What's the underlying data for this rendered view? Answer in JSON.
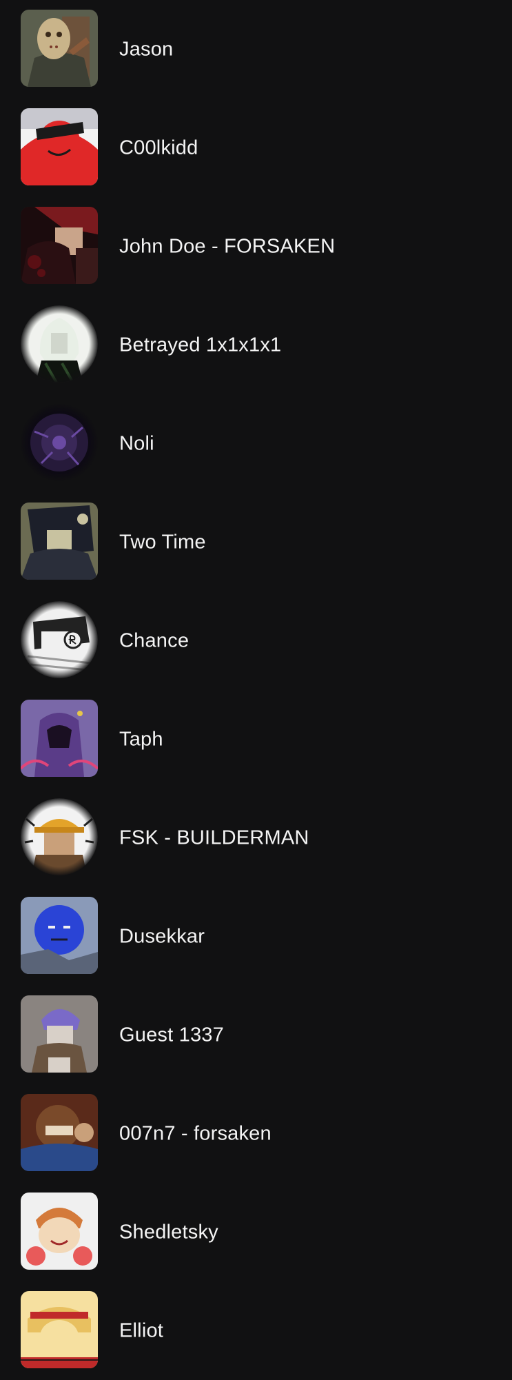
{
  "contacts": [
    {
      "name": "Jason",
      "avatar_icon": "hockey-mask-avatar",
      "colors": [
        "#5b5f4e",
        "#c9b48a",
        "#8a5a3a"
      ]
    },
    {
      "name": "C00lkidd",
      "avatar_icon": "red-kid-sunglasses-avatar",
      "colors": [
        "#e02828",
        "#1a1a1a",
        "#ffffff"
      ]
    },
    {
      "name": "John Doe - FORSAKEN",
      "avatar_icon": "dark-red-figure-avatar",
      "colors": [
        "#1b0b0d",
        "#7a1a1e",
        "#c9a48a"
      ]
    },
    {
      "name": "Betrayed 1x1x1x1",
      "avatar_icon": "white-haired-figure-avatar",
      "colors": [
        "#e8efe6",
        "#2d4a2a",
        "#0f140f"
      ]
    },
    {
      "name": "Noli",
      "avatar_icon": "purple-void-avatar",
      "colors": [
        "#261a3a",
        "#6a4aa2",
        "#0d0a14"
      ]
    },
    {
      "name": "Two Time",
      "avatar_icon": "dark-haired-figure-avatar",
      "colors": [
        "#1c1f2a",
        "#6b6b52",
        "#c8c2a0"
      ]
    },
    {
      "name": "Chance",
      "avatar_icon": "sketch-figure-avatar",
      "colors": [
        "#f0f0f0",
        "#222222",
        "#9a9a9a"
      ]
    },
    {
      "name": "Taph",
      "avatar_icon": "hooded-purple-avatar",
      "colors": [
        "#5a3c88",
        "#1a0f22",
        "#e0457a"
      ]
    },
    {
      "name": "FSK - BUILDERMAN",
      "avatar_icon": "builder-hat-avatar",
      "colors": [
        "#e3a32a",
        "#6a4a2e",
        "#f2f2f2"
      ]
    },
    {
      "name": "Dusekkar",
      "avatar_icon": "blue-face-avatar",
      "colors": [
        "#2a44d6",
        "#8a9ab8",
        "#1a1a2a"
      ]
    },
    {
      "name": "Guest 1337",
      "avatar_icon": "purple-haired-guest-avatar",
      "colors": [
        "#7a6ac8",
        "#6a5440",
        "#d8d0c8"
      ]
    },
    {
      "name": "007n7 - forsaken",
      "avatar_icon": "brown-figure-avatar",
      "colors": [
        "#7a4a2a",
        "#2a4a8a",
        "#e8d8c0"
      ]
    },
    {
      "name": "Shedletsky",
      "avatar_icon": "orange-hair-avatar",
      "colors": [
        "#f0f0f0",
        "#d47a3a",
        "#e85a5a"
      ]
    },
    {
      "name": "Elliot",
      "avatar_icon": "red-headband-avatar",
      "colors": [
        "#f6e0a0",
        "#c02a2a",
        "#2a1a1a"
      ]
    }
  ]
}
